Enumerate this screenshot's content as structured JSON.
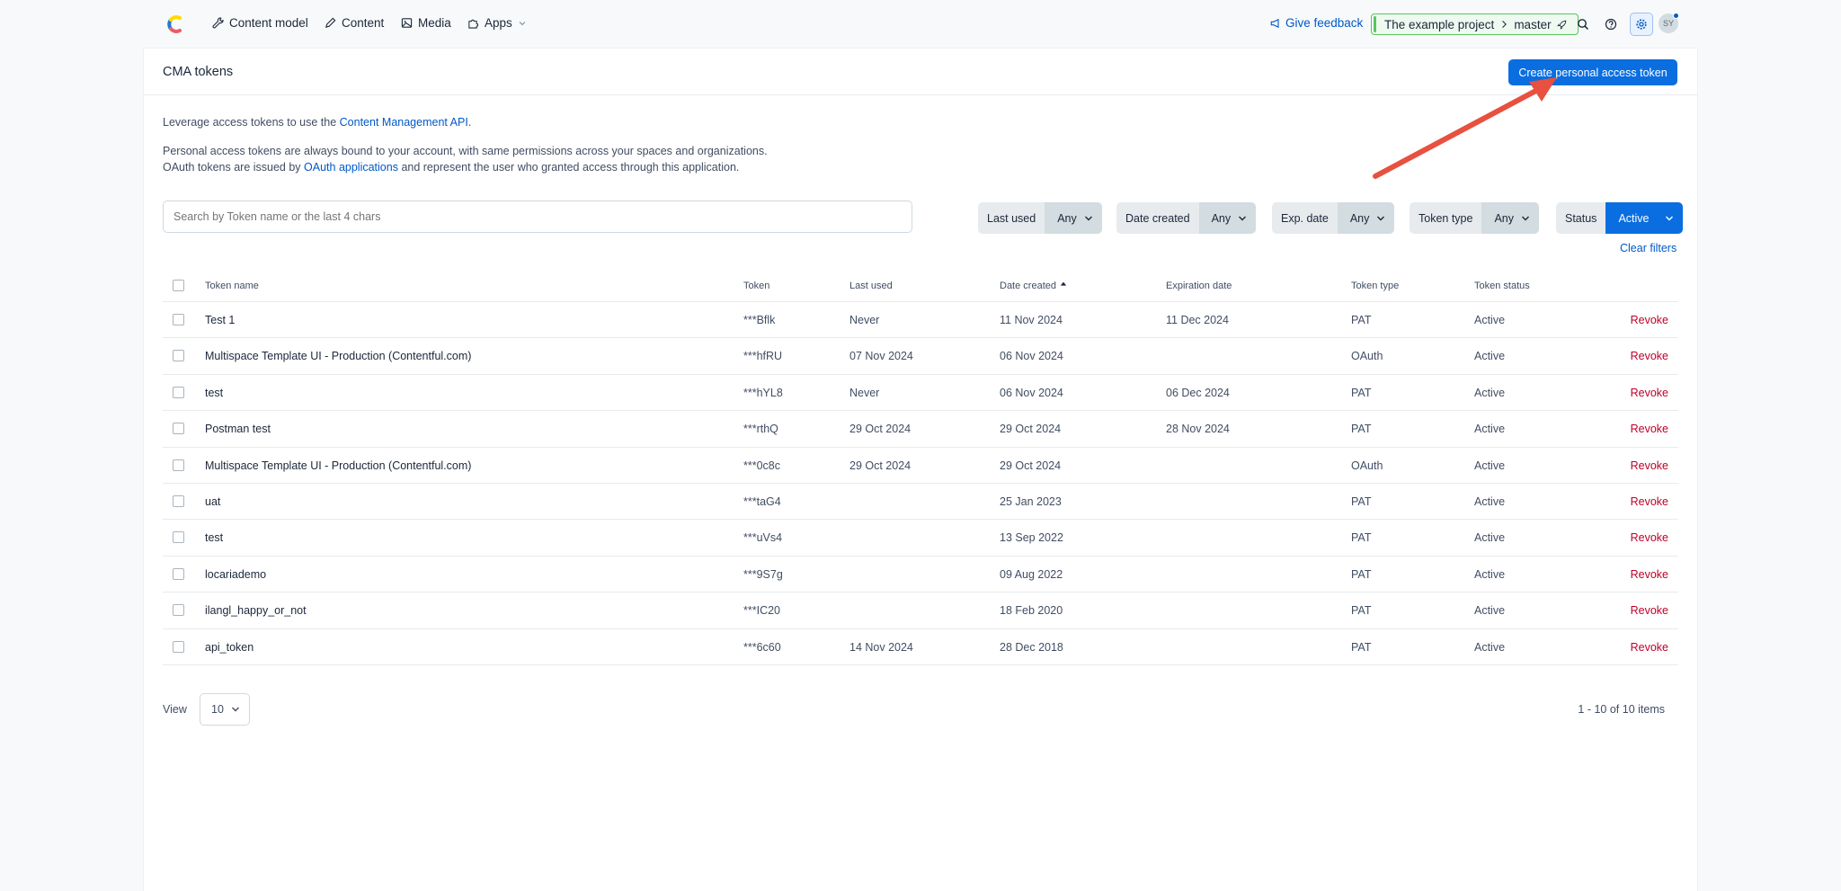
{
  "nav": {
    "items": [
      {
        "label": "Content model",
        "icon": "wrench-icon"
      },
      {
        "label": "Content",
        "icon": "pen-icon"
      },
      {
        "label": "Media",
        "icon": "image-icon"
      },
      {
        "label": "Apps",
        "icon": "puzzle-icon"
      }
    ],
    "feedback": "Give feedback",
    "project": "The example project",
    "environment": "master",
    "avatar": "SY"
  },
  "page": {
    "title": "CMA tokens",
    "create_button": "Create personal access token",
    "intro_prefix": "Leverage access tokens to use the ",
    "intro_link": "Content Management API",
    "intro_suffix": ".",
    "pat_text": "Personal access tokens are always bound to your account, with same permissions across your spaces and organizations.",
    "oauth_prefix": "OAuth tokens are issued by ",
    "oauth_link": "OAuth applications",
    "oauth_suffix": " and represent the user who granted access through this application."
  },
  "search": {
    "placeholder": "Search by Token name or the last 4 chars"
  },
  "filters": [
    {
      "label": "Last used",
      "value": "Any"
    },
    {
      "label": "Date created",
      "value": "Any"
    },
    {
      "label": "Exp. date",
      "value": "Any"
    },
    {
      "label": "Token type",
      "value": "Any"
    },
    {
      "label": "Status",
      "value": "Active"
    }
  ],
  "clear_filters": "Clear filters",
  "table": {
    "headers": {
      "name": "Token name",
      "token": "Token",
      "last_used": "Last used",
      "date_created": "Date created",
      "expiration": "Expiration date",
      "type": "Token type",
      "status": "Token status"
    },
    "revoke_label": "Revoke",
    "rows": [
      {
        "name": "Test 1",
        "token": "***Bflk",
        "last_used": "Never",
        "created": "11 Nov 2024",
        "expires": "11 Dec 2024",
        "type": "PAT",
        "status": "Active"
      },
      {
        "name": "Multispace Template UI - Production (Contentful.com)",
        "token": "***hfRU",
        "last_used": "07 Nov 2024",
        "created": "06 Nov 2024",
        "expires": "",
        "type": "OAuth",
        "status": "Active"
      },
      {
        "name": "test",
        "token": "***hYL8",
        "last_used": "Never",
        "created": "06 Nov 2024",
        "expires": "06 Dec 2024",
        "type": "PAT",
        "status": "Active"
      },
      {
        "name": "Postman test",
        "token": "***rthQ",
        "last_used": "29 Oct 2024",
        "created": "29 Oct 2024",
        "expires": "28 Nov 2024",
        "type": "PAT",
        "status": "Active"
      },
      {
        "name": "Multispace Template UI - Production (Contentful.com)",
        "token": "***0c8c",
        "last_used": "29 Oct 2024",
        "created": "29 Oct 2024",
        "expires": "",
        "type": "OAuth",
        "status": "Active"
      },
      {
        "name": "uat",
        "token": "***taG4",
        "last_used": "",
        "created": "25 Jan 2023",
        "expires": "",
        "type": "PAT",
        "status": "Active"
      },
      {
        "name": "test",
        "token": "***uVs4",
        "last_used": "",
        "created": "13 Sep 2022",
        "expires": "",
        "type": "PAT",
        "status": "Active"
      },
      {
        "name": "locariademo",
        "token": "***9S7g",
        "last_used": "",
        "created": "09 Aug 2022",
        "expires": "",
        "type": "PAT",
        "status": "Active"
      },
      {
        "name": "ilangl_happy_or_not",
        "token": "***IC20",
        "last_used": "",
        "created": "18 Feb 2020",
        "expires": "",
        "type": "PAT",
        "status": "Active"
      },
      {
        "name": "api_token",
        "token": "***6c60",
        "last_used": "14 Nov 2024",
        "created": "28 Dec 2018",
        "expires": "",
        "type": "PAT",
        "status": "Active"
      }
    ]
  },
  "pagination": {
    "view_label": "View",
    "page_size": "10",
    "info": "1 - 10 of 10 items"
  },
  "colors": {
    "primary": "#0a6ee0",
    "link": "#0059c8",
    "danger": "#bd002a",
    "env_green": "#5ac461",
    "annotation_arrow": "#e8503f"
  }
}
